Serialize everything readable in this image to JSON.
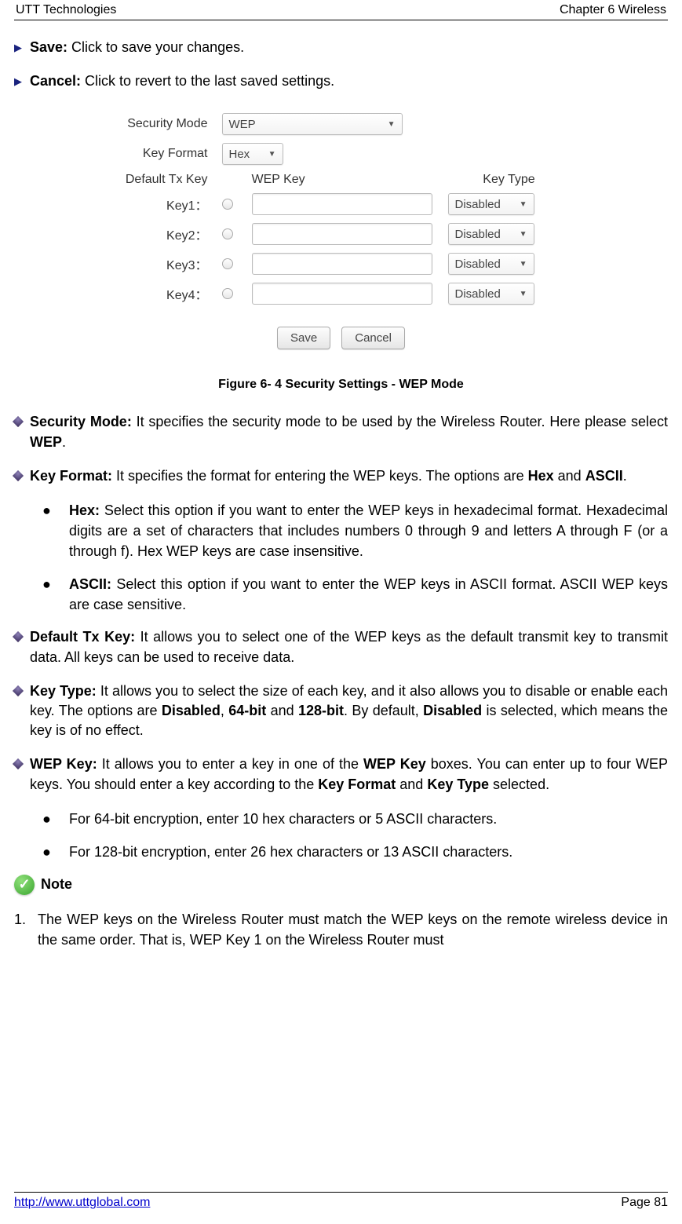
{
  "header": {
    "left": "UTT Technologies",
    "right": "Chapter 6 Wireless"
  },
  "arrows": {
    "save": {
      "label": "Save:",
      "desc": " Click to save your changes."
    },
    "cancel": {
      "label": "Cancel:",
      "desc": " Click to revert to the last saved settings."
    }
  },
  "shot": {
    "secmode_label": "Security Mode",
    "secmode_value": "WEP",
    "keyfmt_label": "Key Format",
    "keyfmt_value": "Hex",
    "deftx_label": "Default Tx Key",
    "wepkey_header": "WEP Key",
    "keytype_header": "Key Type",
    "keys": [
      {
        "label": "Key1：",
        "type": "Disabled"
      },
      {
        "label": "Key2：",
        "type": "Disabled"
      },
      {
        "label": "Key3：",
        "type": "Disabled"
      },
      {
        "label": "Key4：",
        "type": "Disabled"
      }
    ],
    "save_btn": "Save",
    "cancel_btn": "Cancel"
  },
  "figcap": "Figure 6- 4 Security Settings - WEP Mode",
  "bullets": {
    "secmode": {
      "label": "Security Mode: ",
      "text": "It specifies the security mode to be used by the Wireless Router. Here please select ",
      "wep": "WEP",
      "period": "."
    },
    "keyfmt": {
      "label": "Key Format: ",
      "text": "It specifies the format for entering the WEP keys. The options are ",
      "hex": "Hex",
      "and": " and ",
      "ascii": "ASCII",
      "period": "."
    },
    "hex": {
      "label": "Hex: ",
      "text": "Select this option if you want to enter the WEP keys in hexadecimal format. Hexadecimal digits are a set of characters that includes numbers 0 through 9 and letters A through F (or a through f). Hex WEP keys are case insensitive."
    },
    "ascii": {
      "label": "ASCII: ",
      "text": "Select this option if you want to enter the WEP keys in ASCII format. ASCII WEP keys are case sensitive."
    },
    "deftx": {
      "label": "Default Tx Key: ",
      "text": "It allows you to select one of the WEP keys as the default transmit key to transmit data. All keys can be used to receive data."
    },
    "keytype": {
      "label": "Key Type: ",
      "t1": "It allows you to select the size of each key, and it also allows you to disable or enable each key. The options are ",
      "b1": "Disabled",
      "c1": ", ",
      "b2": "64-bit",
      "and": " and ",
      "b3": "128-bit",
      "t2": ". By default, ",
      "b4": "Disabled",
      "t3": " is selected, which means the key is of no effect."
    },
    "wepkey": {
      "label": "WEP Key: ",
      "t1": "It allows you to enter a key in one of the ",
      "b1": "WEP Key",
      "t2": " boxes. You can enter up to four WEP keys. You should enter a key according to the ",
      "b2": "Key Format",
      "and": " and ",
      "b3": "Key Type",
      "t3": " selected."
    },
    "enc64": "For 64-bit encryption, enter 10 hex characters or 5 ASCII characters.",
    "enc128": "For 128-bit encryption, enter 26 hex characters or 13 ASCII characters."
  },
  "note_label": "Note",
  "note1": {
    "num": "1.",
    "text": "The WEP keys on the Wireless Router must match the WEP keys on the remote wireless device in the same order. That is, WEP Key 1 on the Wireless Router must"
  },
  "footer": {
    "url": "http://www.uttglobal.com",
    "page": "Page 81"
  }
}
